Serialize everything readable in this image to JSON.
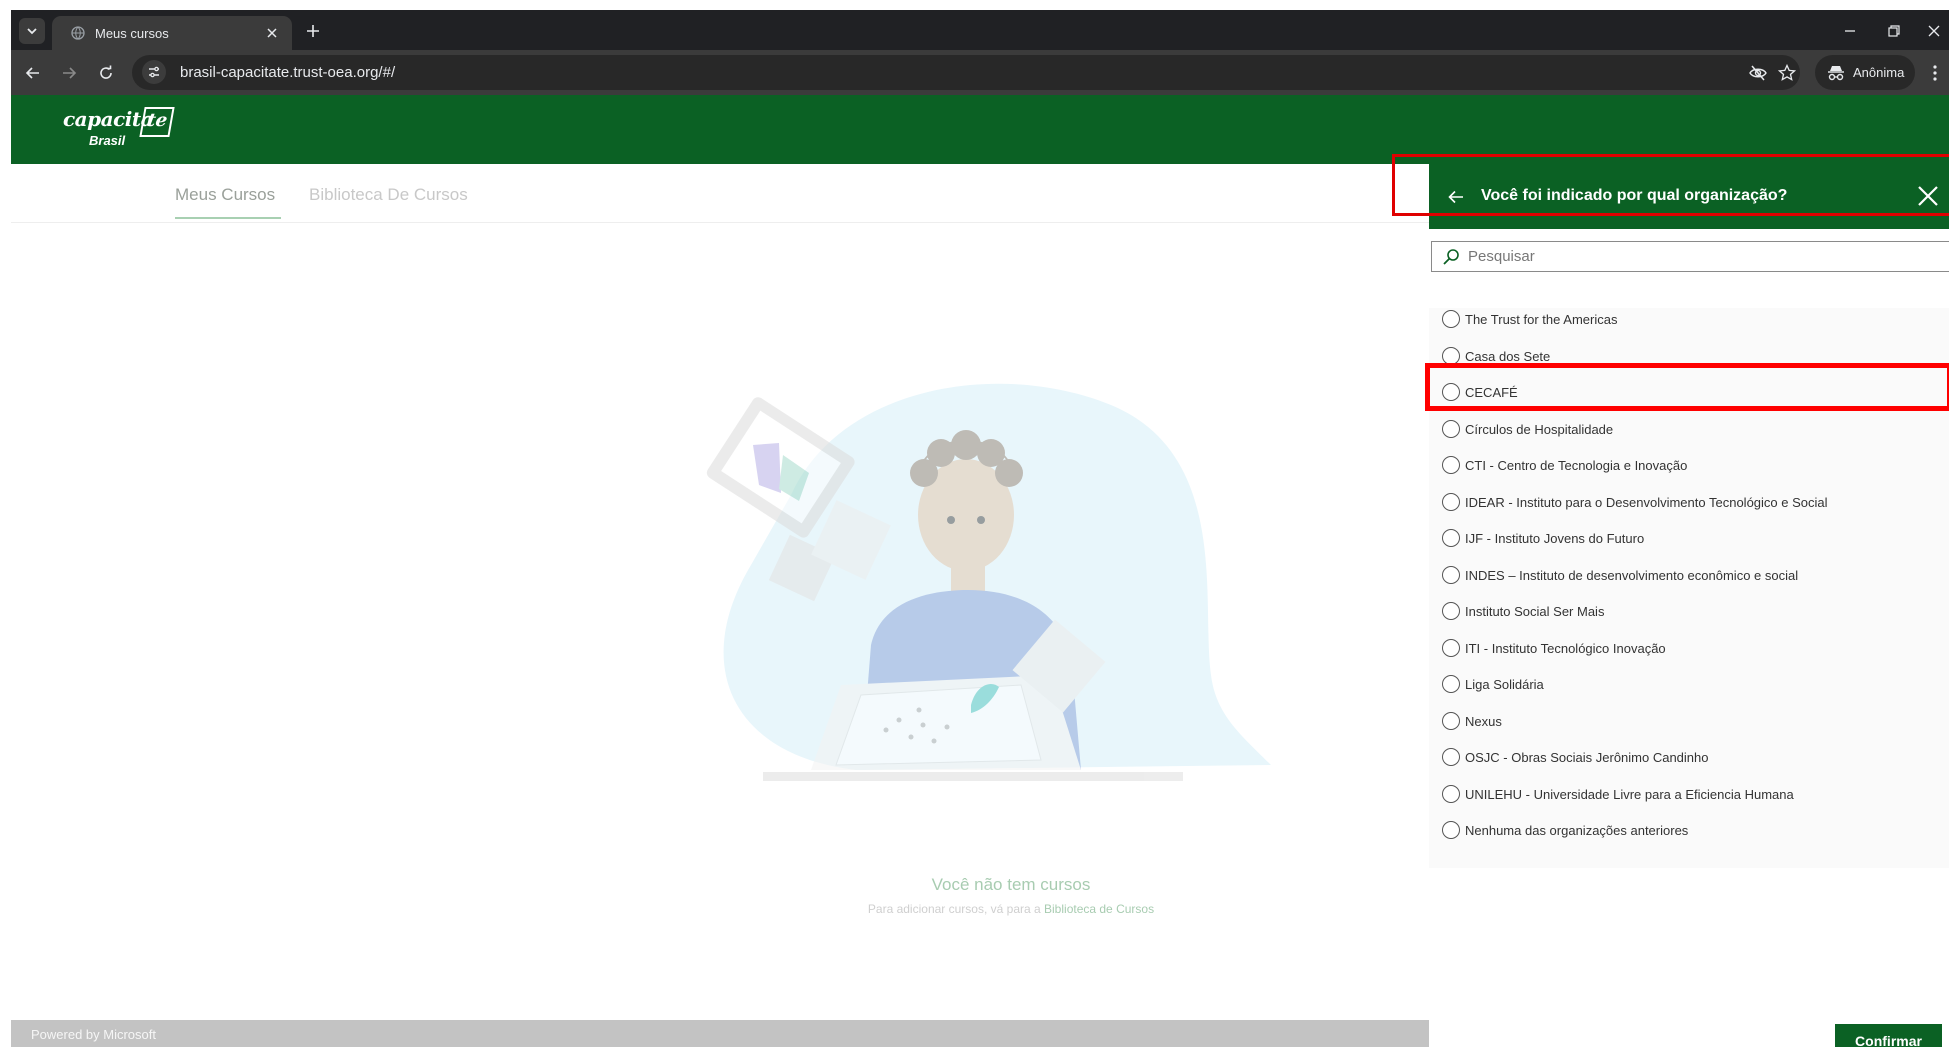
{
  "browser": {
    "tab_title": "Meus cursos",
    "url": "brasil-capacitate.trust-oea.org/#/",
    "incognito_label": "Anônima",
    "icons": [
      "tab-list-icon",
      "globe-icon",
      "close-icon",
      "plus-icon",
      "minimize-icon",
      "restore-icon",
      "back-arrow-icon",
      "forward-arrow-icon",
      "reload-icon",
      "site-settings-icon",
      "eye-off-icon",
      "star-icon",
      "incognito-icon",
      "kebab-menu-icon"
    ]
  },
  "app": {
    "logo": {
      "text": "capacita",
      "mark": "te",
      "subtitle": "Brasil"
    },
    "nav": {
      "tabs": [
        "Meus Cursos",
        "Biblioteca De Cursos"
      ],
      "active_tab": "Meus Cursos"
    },
    "empty_state": {
      "title": "Você não tem cursos",
      "subtitle": "Para adicionar cursos, vá para a",
      "link": "Biblioteca de Cursos"
    },
    "footer": "Powered by Microsoft",
    "colors": {
      "brand_green": "#0b6124",
      "highlight_red": "#ff0000"
    }
  },
  "panel": {
    "title": "Você foi indicado por qual organização?",
    "search_placeholder": "Pesquisar",
    "search_value": "",
    "organizations": [
      "The Trust for the Americas",
      "Casa dos Sete",
      "CECAFÉ",
      "Círculos de Hospitalidade",
      "CTI - Centro de Tecnologia e Inovação",
      "IDEAR - Instituto para o Desenvolvimento Tecnológico e Social",
      "IJF - Instituto Jovens do Futuro",
      "INDES – Instituto de desenvolvimento econômico e social",
      "Instituto Social Ser Mais",
      "ITI - Instituto Tecnológico Inovação",
      "Liga Solidária",
      "Nexus",
      "OSJC - Obras Sociais Jerônimo Candinho",
      "UNILEHU - Universidade Livre para a Eficiencia Humana",
      "Nenhuma das organizações anteriores"
    ],
    "confirm_label": "Confirmar"
  }
}
